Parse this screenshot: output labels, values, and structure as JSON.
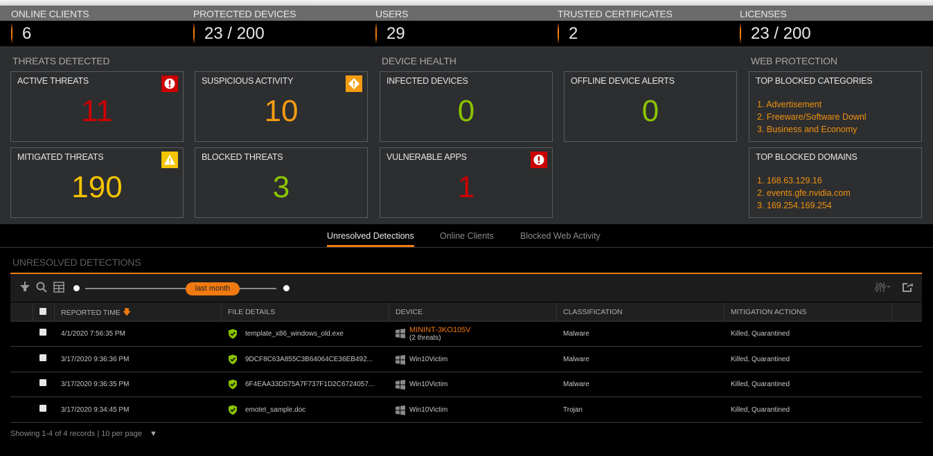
{
  "stats": [
    {
      "label": "ONLINE CLIENTS",
      "value": "6"
    },
    {
      "label": "PROTECTED DEVICES",
      "value": "23 / 200"
    },
    {
      "label": "USERS",
      "value": "29"
    },
    {
      "label": "TRUSTED CERTIFICATES",
      "value": "2"
    },
    {
      "label": "LICENSES",
      "value": "23 / 200"
    }
  ],
  "sections": {
    "threats": "THREATS DETECTED",
    "device_health": "DEVICE HEALTH",
    "web_protection": "WEB PROTECTION"
  },
  "cards": {
    "active_threats": {
      "title": "ACTIVE THREATS",
      "value": "11",
      "icon": "error-icon",
      "color": "#cc0000"
    },
    "suspicious_activity": {
      "title": "SUSPICIOUS ACTIVITY",
      "value": "10",
      "icon": "warning-diamond-icon",
      "color": "#f39c12"
    },
    "mitigated_threats": {
      "title": "MITIGATED THREATS",
      "value": "190",
      "icon": "warning-triangle-icon",
      "color": "#f5c400"
    },
    "blocked_threats": {
      "title": "BLOCKED THREATS",
      "value": "3",
      "color": "#8bc400"
    },
    "infected_devices": {
      "title": "INFECTED DEVICES",
      "value": "0",
      "color": "#8bc400"
    },
    "offline_device_alerts": {
      "title": "OFFLINE DEVICE ALERTS",
      "value": "0",
      "color": "#8bc400"
    },
    "vulnerable_apps": {
      "title": "VULNERABLE APPS",
      "value": "1",
      "icon": "error-icon",
      "color": "#cc0000"
    },
    "top_blocked_categories": {
      "title": "TOP BLOCKED CATEGORIES",
      "items": [
        "1. Advertisement",
        "2. Freeware/Software Downl",
        "3. Business and Economy"
      ]
    },
    "top_blocked_domains": {
      "title": "TOP BLOCKED DOMAINS",
      "items": [
        "1. 168.63.129.16",
        "2. events.gfe.nvidia.com",
        "3. 169.254.169.254"
      ]
    }
  },
  "tabs": [
    {
      "label": "Unresolved Detections",
      "active": true
    },
    {
      "label": "Online Clients",
      "active": false
    },
    {
      "label": "Blocked Web Activity",
      "active": false
    }
  ],
  "detections": {
    "title": "UNRESOLVED DETECTIONS",
    "slider_label": "last month",
    "columns": [
      "REPORTED TIME",
      "FILE DETAILS",
      "DEVICE",
      "CLASSIFICATION",
      "MITIGATION ACTIONS"
    ],
    "rows": [
      {
        "time": "4/1/2020 7:56:35 PM",
        "file": "template_x86_windows_old.exe",
        "device": "MININT-3KO105V",
        "device_sub": "(2 threats)",
        "classification": "Malware",
        "mitigation": "Killed, Quarantined"
      },
      {
        "time": "3/17/2020 9:36:36 PM",
        "file": "9DCF8C63A855C3B64064CE36EB492...",
        "device": "Win10Victim",
        "device_sub": "",
        "classification": "Malware",
        "mitigation": "Killed, Quarantined"
      },
      {
        "time": "3/17/2020 9:36:35 PM",
        "file": "6F4EAA33D575A7F737F1D2C6724057...",
        "device": "Win10Victim",
        "device_sub": "",
        "classification": "Malware",
        "mitigation": "Killed, Quarantined"
      },
      {
        "time": "3/17/2020 9:34:45 PM",
        "file": "emotet_sample.doc",
        "device": "Win10Victim",
        "device_sub": "",
        "classification": "Trojan",
        "mitigation": "Killed, Quarantined"
      }
    ],
    "footer": "Showing 1-4 of 4 records | 10 per page"
  }
}
